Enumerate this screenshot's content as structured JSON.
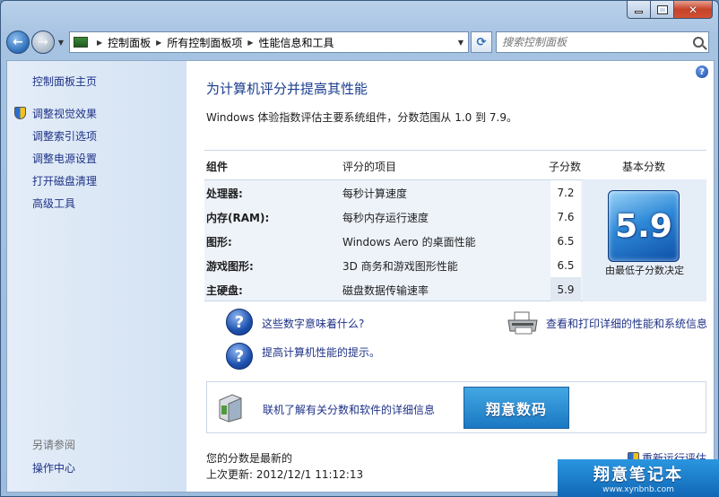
{
  "window": {
    "min_glyph": "",
    "close_glyph": "✕"
  },
  "nav": {
    "back_glyph": "←",
    "forward_glyph": "→",
    "breadcrumbs": [
      "控制面板",
      "所有控制面板项",
      "性能信息和工具"
    ],
    "search_placeholder": "搜索控制面板",
    "refresh_glyph": "⟳"
  },
  "sidebar": {
    "home": "控制面板主页",
    "tasks": [
      "调整视觉效果",
      "调整索引选项",
      "调整电源设置",
      "打开磁盘清理",
      "高级工具"
    ],
    "see_also_heading": "另请参阅",
    "see_also": [
      "操作中心"
    ]
  },
  "main": {
    "title": "为计算机评分并提高其性能",
    "intro": "Windows 体验指数评估主要系统组件，分数范围从 1.0 到 7.9。",
    "table": {
      "headers": {
        "component": "组件",
        "rated": "评分的项目",
        "subscore": "子分数",
        "base": "基本分数"
      },
      "rows": [
        {
          "component": "处理器:",
          "item": "每秒计算速度",
          "score": "7.2"
        },
        {
          "component": "内存(RAM):",
          "item": "每秒内存运行速度",
          "score": "7.6"
        },
        {
          "component": "图形:",
          "item": "Windows Aero 的桌面性能",
          "score": "6.5"
        },
        {
          "component": "游戏图形:",
          "item": "3D 商务和游戏图形性能",
          "score": "6.5"
        },
        {
          "component": "主硬盘:",
          "item": "磁盘数据传输速率",
          "score": "5.9"
        }
      ],
      "base_score": "5.9",
      "base_caption": "由最低子分数决定"
    },
    "help_glyph": "?",
    "links": {
      "what_mean": "这些数字意味着什么?",
      "tips": "提高计算机性能的提示。",
      "print_details": "查看和打印详细的性能和系统信息"
    },
    "promo": {
      "link": "联机了解有关分数和软件的详细信息",
      "banner": "翔意数码"
    },
    "status": {
      "current": "您的分数是最新的",
      "last_update": "上次更新: 2012/12/1 11:12:13",
      "rerun": "重新运行评估"
    }
  },
  "watermark": {
    "title": "翔意笔记本",
    "url": "www.xynbnb.com"
  }
}
